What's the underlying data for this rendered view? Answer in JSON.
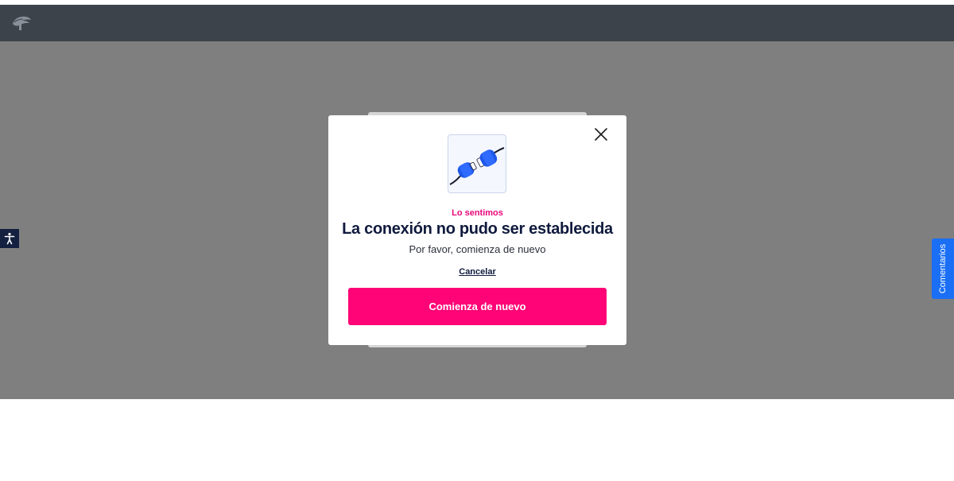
{
  "navbar": {
    "logo_icon": "eagle-logo-icon"
  },
  "modal": {
    "illustration_icon": "unplugged-connector-icon",
    "eyebrow": "Lo sentimos",
    "title": "La conexión no pudo ser establecida",
    "subtitle": "Por favor, comienza de nuevo",
    "cancel_label": "Cancelar",
    "cta_label": "Comienza de nuevo",
    "close_icon": "close-icon"
  },
  "accessibility": {
    "icon": "accessibility-icon"
  },
  "feedback": {
    "label": "Comentarios"
  },
  "colors": {
    "navbar_bg": "#3d434b",
    "overlay": "#7f7f7f",
    "accent_pink": "#ff0476",
    "eyebrow_pink": "#e8077a",
    "title_navy": "#0f1a3d",
    "feedback_blue": "#1a6ff5"
  }
}
